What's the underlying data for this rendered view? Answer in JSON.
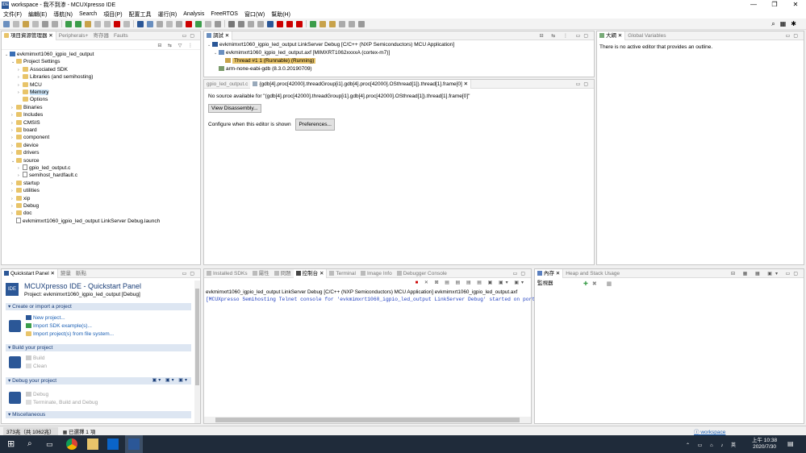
{
  "window": {
    "title": "workspace - 我不到渗 - MCUXpresso IDE",
    "controls": [
      "—",
      "❐",
      "✕"
    ]
  },
  "menu": [
    "文件(F)",
    "編輯(E)",
    "導航(N)",
    "Search",
    "項目(P)",
    "配置工具",
    "運行(R)",
    "Analysis",
    "FreeRTOS",
    "窗口(W)",
    "幫助(H)"
  ],
  "project_explorer": {
    "tabs": [
      "項目資源管理器",
      "Peripherals+",
      "寄存器",
      "Faults"
    ],
    "tree": [
      {
        "label": "evkmimxrt1060_igpio_led_output",
        "depth": 0,
        "icon": "proj",
        "tw": "⌄"
      },
      {
        "label": "Project Settings",
        "depth": 1,
        "icon": "folder",
        "tw": "⌄"
      },
      {
        "label": "Associated SDK",
        "depth": 2,
        "icon": "folder",
        "tw": "›"
      },
      {
        "label": "Libraries (and semihosting)",
        "depth": 2,
        "icon": "folder",
        "tw": "›"
      },
      {
        "label": "MCU",
        "depth": 2,
        "icon": "folder",
        "tw": "›"
      },
      {
        "label": "Memory",
        "depth": 2,
        "icon": "folder",
        "tw": "›",
        "selected": true
      },
      {
        "label": "Options",
        "depth": 2,
        "icon": "folder",
        "tw": ""
      },
      {
        "label": "Binaries",
        "depth": 1,
        "icon": "folder",
        "tw": "›"
      },
      {
        "label": "Includes",
        "depth": 1,
        "icon": "folder",
        "tw": "›"
      },
      {
        "label": "CMSIS",
        "depth": 1,
        "icon": "folder",
        "tw": "›"
      },
      {
        "label": "board",
        "depth": 1,
        "icon": "folder",
        "tw": "›"
      },
      {
        "label": "component",
        "depth": 1,
        "icon": "folder",
        "tw": "›"
      },
      {
        "label": "device",
        "depth": 1,
        "icon": "folder",
        "tw": "›"
      },
      {
        "label": "drivers",
        "depth": 1,
        "icon": "folder",
        "tw": "›"
      },
      {
        "label": "source",
        "depth": 1,
        "icon": "folder",
        "tw": "⌄"
      },
      {
        "label": "gpio_led_output.c",
        "depth": 2,
        "icon": "file",
        "tw": "›"
      },
      {
        "label": "semihost_hardfault.c",
        "depth": 2,
        "icon": "file",
        "tw": "›"
      },
      {
        "label": "startup",
        "depth": 1,
        "icon": "folder",
        "tw": "›"
      },
      {
        "label": "utilities",
        "depth": 1,
        "icon": "folder",
        "tw": "›"
      },
      {
        "label": "xip",
        "depth": 1,
        "icon": "folder",
        "tw": "›"
      },
      {
        "label": "Debug",
        "depth": 1,
        "icon": "folder",
        "tw": "›"
      },
      {
        "label": "doc",
        "depth": 1,
        "icon": "folder",
        "tw": "›"
      },
      {
        "label": "evkmimxrt1060_igpio_led_output LinkServer Debug.launch",
        "depth": 1,
        "icon": "file",
        "tw": ""
      }
    ]
  },
  "debug_view": {
    "tab": "調試",
    "rows": [
      {
        "label": "evkmimxrt1060_igpio_led_output LinkServer Debug [C/C++ (NXP Semiconductors) MCU Application]",
        "depth": 0
      },
      {
        "label": "evkmimxrt1060_igpio_led_output.axf [MIMXRT1062xxxxA (cortex-m7)]",
        "depth": 1
      },
      {
        "label": "Thread #1 1 (Runnable) (Running)",
        "depth": 2,
        "selected": true
      },
      {
        "label": "arm-none-eabi-gdb (8.3.0.20190709)",
        "depth": 1
      }
    ]
  },
  "editor": {
    "tabs": [
      "gpio_led_output.c",
      "{gdb[4].proc[42000].threadGroup[i1].gdb[4].proc[42000].OSthread[1]).thread[1].frame[0]"
    ],
    "message": "No source available for \"(gdb[4].proc[42000].threadGroup[i1].gdb[4].proc[42000].OSthread[1]).thread[1].frame[0]\"",
    "view_disassembly": "View Disassembly...",
    "configure_text": "Configure when this editor is shown",
    "preferences": "Preferences..."
  },
  "outline": {
    "tabs": [
      "大綱",
      "Global Variables"
    ],
    "message": "There is no active editor that provides an outline."
  },
  "quickstart": {
    "tabs": [
      "Quickstart Panel",
      "變量",
      "斷點"
    ],
    "title": "MCUXpresso IDE - Quickstart Panel",
    "project": "Project: evkmimxrt1060_igpio_led_output [Debug]",
    "sections": {
      "create": "Create or import a project",
      "build": "Build your project",
      "debug": "Debug your project",
      "misc": "Miscellaneous"
    },
    "create_items": [
      "New project...",
      "Import SDK example(s)...",
      "Import project(s) from file system..."
    ],
    "build_items": [
      "Build",
      "Clean"
    ],
    "debug_items": [
      "Debug",
      "Terminate, Build and Debug"
    ]
  },
  "console": {
    "tabs": [
      "Installed SDKs",
      "屬性",
      "問題",
      "控制台",
      "Terminal",
      "Image Info",
      "Debugger Console"
    ],
    "header": "evkmimxrt1060_igpio_led_output LinkServer Debug [C/C++ (NXP Semiconductors) MCU Application] evkmimxrt1060_igpio_led_output.axf",
    "line": "[MCUXpresso Semihosting Telnet console for 'evkmimxrt1060_igpio_led_output LinkServer Debug' started on port"
  },
  "memory": {
    "tabs": [
      "內存",
      "Heap and Stack Usage"
    ],
    "monitors_label": "監視器"
  },
  "status": {
    "left": "373兆（共 1062兆）",
    "selection": "已選擇 1 項",
    "workspace": "workspace"
  },
  "taskbar": {
    "time": "上午 10:38",
    "date": "2020/7/30"
  },
  "colors": {
    "accent": "#2b5797",
    "link": "#1a5fb4",
    "selection": "#cce4f7",
    "console_blue": "#1f3fbf"
  }
}
